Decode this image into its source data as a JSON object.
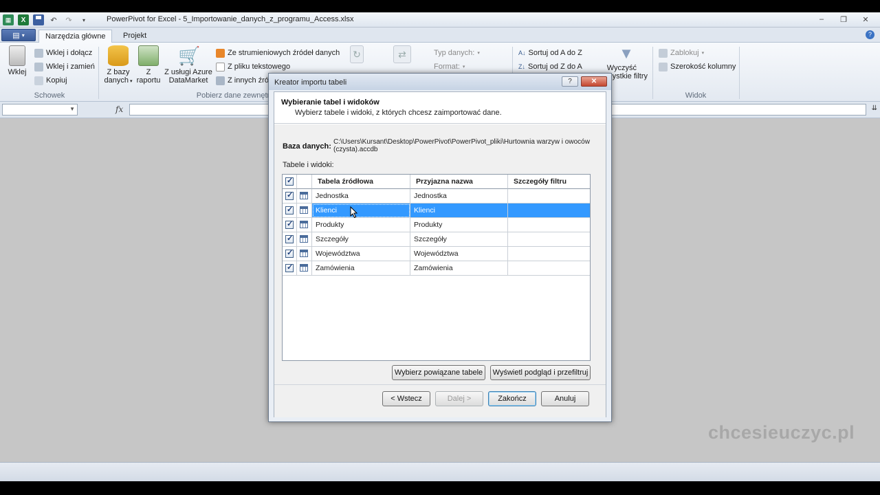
{
  "window": {
    "title": "PowerPivot for Excel - 5_Importowanie_danych_z_programu_Access.xlsx",
    "controls": [
      "–",
      "❐",
      "✕"
    ]
  },
  "tabs": [
    {
      "label": "Narzędzia główne",
      "active": true
    },
    {
      "label": "Projekt",
      "active": false
    }
  ],
  "ribbon": {
    "clipboard": {
      "paste": "Wklej",
      "paste_append": "Wklej i dołącz",
      "paste_replace": "Wklej i zamień",
      "copy": "Kopiuj",
      "group": "Schowek"
    },
    "get_data": {
      "from_db_1": "Z bazy",
      "from_db_2": "danych",
      "from_report_1": "Z",
      "from_report_2": "raportu",
      "from_azure_1": "Z usługi Azure",
      "from_azure_2": "DataMarket",
      "from_feeds": "Ze strumieniowych źródeł danych",
      "from_text": "Z pliku tekstowego",
      "from_other": "Z innych źró",
      "group": "Pobierz dane zewnętr"
    },
    "format": {
      "data_type": "Typ danych:",
      "format": "Format:"
    },
    "sort": {
      "sort_az": "Sortuj od A do Z",
      "sort_za": "Sortuj od Z do A",
      "clear_filters_1": "Wyczyść",
      "clear_filters_2": "ystkie filtry"
    },
    "view": {
      "freeze": "Zablokuj",
      "column_width": "Szerokość kolumny",
      "group": "Widok"
    }
  },
  "formula_bar": {
    "fx": "fx"
  },
  "dialog": {
    "title": "Kreator importu tabeli",
    "help": "?",
    "close": "✕",
    "header_title": "Wybieranie tabel i widoków",
    "header_subtitle": "Wybierz tabele i widoki, z których chcesz zaimportować dane.",
    "db_label": "Baza danych:",
    "db_path": "C:\\Users\\Kursant\\Desktop\\PowerPivot\\PowerPivot_pliki\\Hurtownia warzyw i owoców (czysta).accdb",
    "tables_label": "Tabele i widoki:",
    "columns": [
      "Tabela źródłowa",
      "Przyjazna nazwa",
      "Szczegóły filtru"
    ],
    "rows": [
      {
        "source": "Jednostka",
        "friendly": "Jednostka",
        "filter": "",
        "checked": true,
        "selected": false
      },
      {
        "source": "Klienci",
        "friendly": "Klienci",
        "filter": "",
        "checked": true,
        "selected": true
      },
      {
        "source": "Produkty",
        "friendly": "Produkty",
        "filter": "",
        "checked": true,
        "selected": false
      },
      {
        "source": "Szczegóły",
        "friendly": "Szczegóły",
        "filter": "",
        "checked": true,
        "selected": false
      },
      {
        "source": "Województwa",
        "friendly": "Województwa",
        "filter": "",
        "checked": true,
        "selected": false
      },
      {
        "source": "Zamówienia",
        "friendly": "Zamówienia",
        "filter": "",
        "checked": true,
        "selected": false
      }
    ],
    "btn_related": "Wybierz powiązane tabele",
    "btn_preview": "Wyświetl podgląd i przefiltruj",
    "btn_back": "< Wstecz",
    "btn_next": "Dalej >",
    "btn_finish": "Zakończ",
    "btn_cancel": "Anuluj"
  },
  "watermark": "chcesieuczyc.pl"
}
